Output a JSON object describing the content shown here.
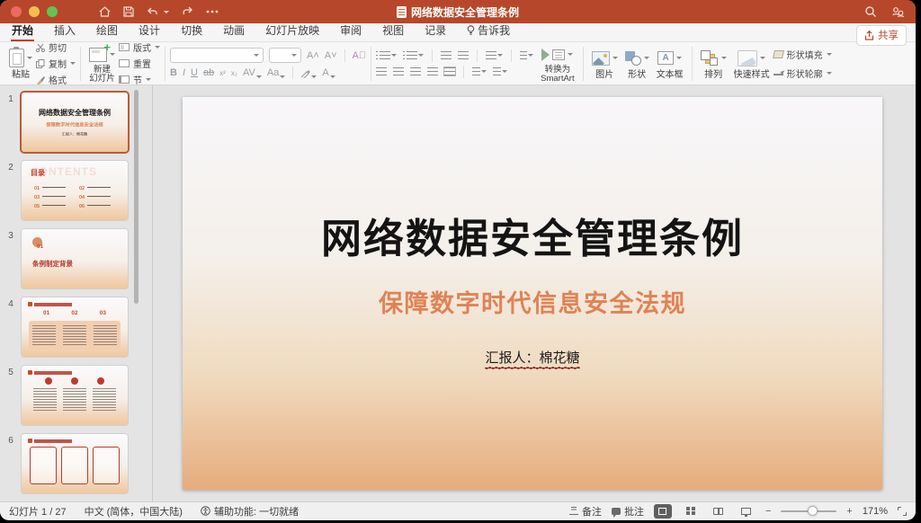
{
  "titlebar": {
    "title": "网络数据安全管理条例",
    "share_label": "共享"
  },
  "tabs": {
    "items": [
      "开始",
      "插入",
      "绘图",
      "设计",
      "切换",
      "动画",
      "幻灯片放映",
      "审阅",
      "视图",
      "记录",
      "告诉我"
    ],
    "active": "开始"
  },
  "ribbon": {
    "paste": "粘贴",
    "cut": "剪切",
    "copy": "复制",
    "format_painter": "格式",
    "new_slide_l1": "新建",
    "new_slide_l2": "幻灯片",
    "layout": "版式",
    "reset": "重置",
    "section": "节",
    "font_glyphs": {
      "bold": "B",
      "italic": "I",
      "underline": "U",
      "strike": "ab",
      "sup": "x²",
      "sub": "x₂",
      "spacing": "AV",
      "case": "Aa",
      "grow": "A˄",
      "shrink": "A˅",
      "clear": "A⃠",
      "color": "A"
    },
    "convert_l1": "转换为",
    "convert_l2": "SmartArt",
    "picture": "图片",
    "shapes": "形状",
    "textbox": "文本框",
    "arrange": "排列",
    "quick_styles": "快速样式",
    "shape_fill": "形状填充",
    "shape_outline": "形状轮廓"
  },
  "slide": {
    "title": "网络数据安全管理条例",
    "subtitle": "保障数字时代信息安全法规",
    "presenter": "汇报人：棉花糖"
  },
  "thumbnails": {
    "items": [
      {
        "num": "1",
        "title": "网络数据安全管理条例",
        "subtitle": "保障数字时代信息安全法规",
        "presenter": "汇报人：棉花糖"
      },
      {
        "num": "2",
        "title": "目录",
        "watermark": "CONTENTS",
        "entries": [
          "01",
          "02",
          "03",
          "04",
          "05",
          "06"
        ]
      },
      {
        "num": "3",
        "badge": "01",
        "title": "条例制定背景"
      },
      {
        "num": "4",
        "badges": [
          "01",
          "02",
          "03"
        ]
      },
      {
        "num": "5"
      },
      {
        "num": "6"
      }
    ]
  },
  "statusbar": {
    "slide_info": "幻灯片 1 / 27",
    "language": "中文 (简体，中国大陆)",
    "accessibility": "辅助功能: 一切就绪",
    "notes": "备注",
    "comments": "批注",
    "zoom_out": "−",
    "zoom_in": "+",
    "zoom_level": "171%"
  }
}
